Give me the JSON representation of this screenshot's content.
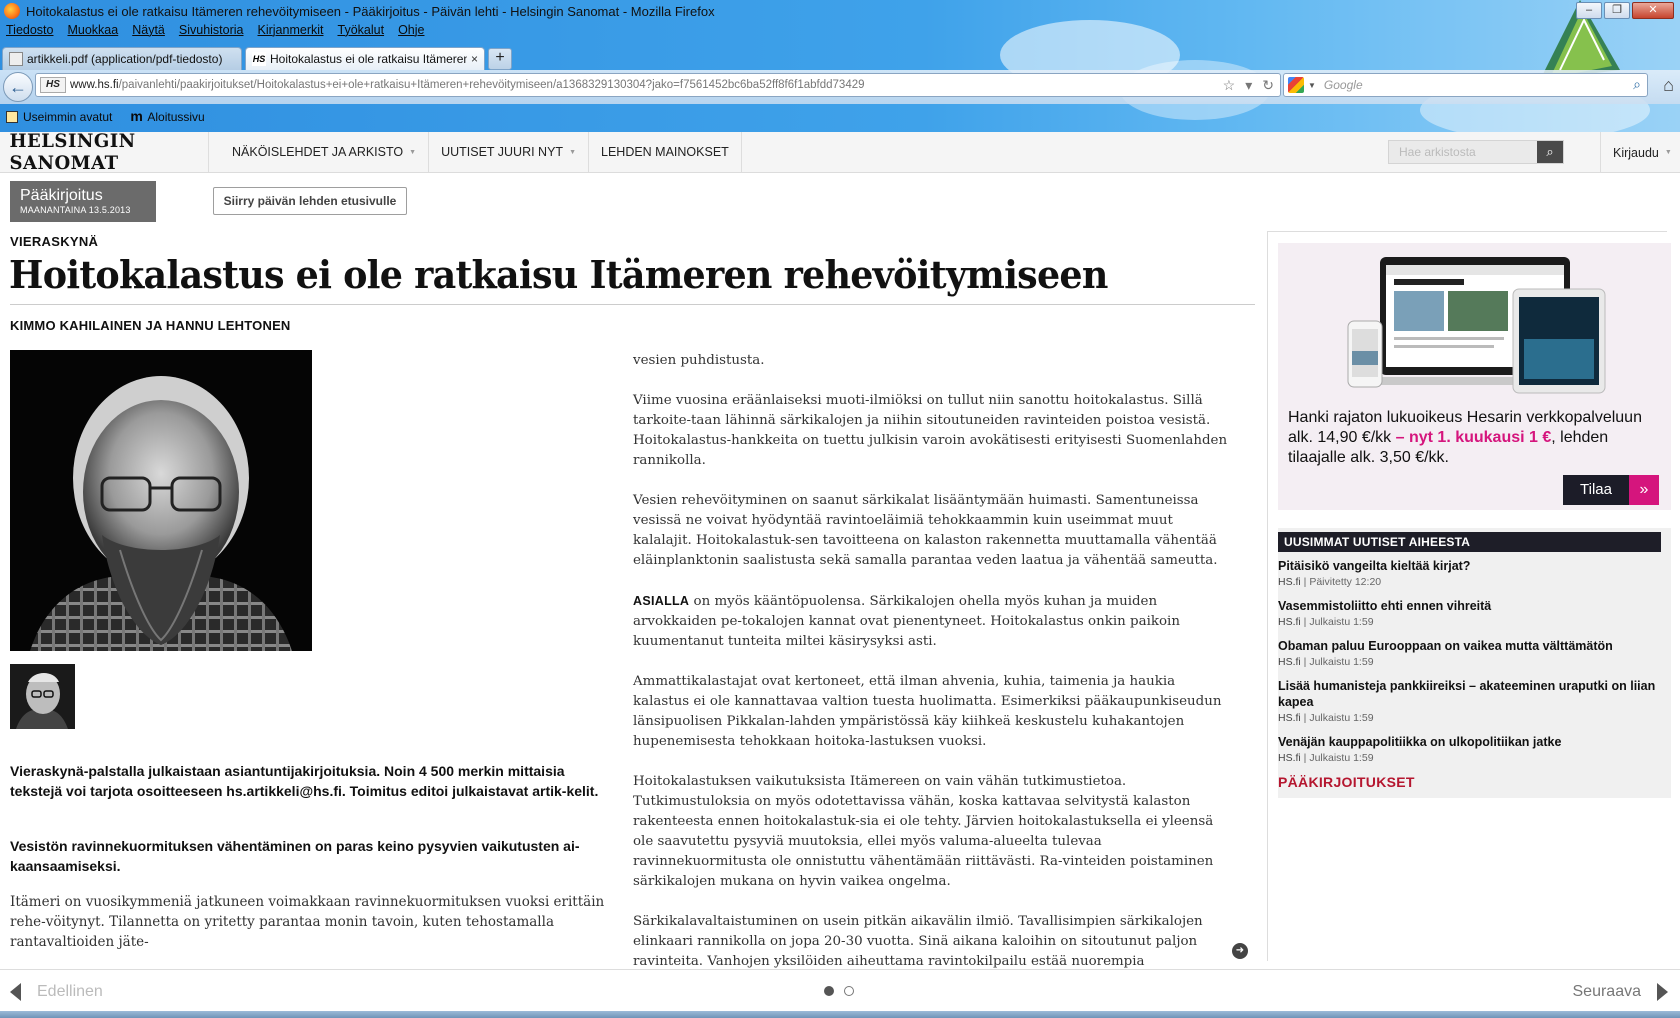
{
  "browser": {
    "window_title": "Hoitokalastus ei ole ratkaisu Itämeren rehevöitymiseen - Pääkirjoitus - Päivän lehti - Helsingin Sanomat - Mozilla Firefox",
    "menu": [
      "Tiedosto",
      "Muokkaa",
      "Näytä",
      "Sivuhistoria",
      "Kirjanmerkit",
      "Työkalut",
      "Ohje"
    ],
    "tabs": [
      {
        "label": "artikkeli.pdf (application/pdf-tiedosto)",
        "favicon": "pdf-icon",
        "active": false
      },
      {
        "label": "Hoitokalastus ei ole ratkaisu Itämeren rehevöitymiseen",
        "favicon": "hs-icon",
        "active": true
      }
    ],
    "newtab_label": "+",
    "tab_close": "×",
    "site_badge": "HS",
    "url_host": "www.hs.fi",
    "url_path": "/paivanlehti/paakirjoitukset/Hoitokalastus+ei+ole+ratkaisu+Itämeren+rehevöitymiseen/a1368329130304?jako=f7561452bc6ba52ff8f6f1abfdd73429",
    "search_placeholder": "Google",
    "bookmarks": [
      "Useimmin avatut",
      "Aloitussivu"
    ]
  },
  "site": {
    "logo": "HELSINGIN SANOMAT",
    "nav": [
      "NÄKÖISLEHDET JA ARKISTO",
      "UUTISET JUURI NYT",
      "LEHDEN MAINOKSET"
    ],
    "search_placeholder": "Hae arkistosta",
    "login": "Kirjaudu"
  },
  "article": {
    "section": "Pääkirjoitus",
    "date": "MAANANTAINA 13.5.2013",
    "frontpage_button": "Siirry päivän lehden etusivulle",
    "kicker": "VIERASKYNÄ",
    "headline": "Hoitokalastus ei ole ratkaisu Itämeren rehevöitymiseen",
    "authors": "KIMMO KAHILAINEN JA HANNU LEHTONEN",
    "left_paragraphs": [
      "Vieraskynä-palstalla julkaistaan asiantuntijakirjoituksia. Noin 4 500 merkin mittaisia tekstejä voi tarjota osoitteeseen hs.artikkeli@hs.fi. Toimitus editoi julkaistavat artik-kelit.",
      "Vesistön ravinnekuormituksen vähentäminen on paras keino pysyvien vaikutusten ai-kaansaamiseksi.",
      "Itämeri on vuosikymmeniä jatkuneen voimakkaan ravinnekuormituksen vuoksi erittäin rehe-vöitynyt. Tilannetta on yritetty parantaa monin tavoin, kuten tehostamalla rantavaltioiden jäte-"
    ],
    "right_paragraphs": [
      "vesien puhdistusta.",
      "Viime vuosina eräänlaiseksi muoti-ilmiöksi on tullut niin sanottu hoitokalastus. Sillä tarkoite-taan lähinnä särkikalojen ja niihin sitoutuneiden ravinteiden poistoa vesistä. Hoitokalastus-hankkeita on tuettu julkisin varoin avokätisesti erityisesti Suomenlahden rannikolla.",
      "Vesien rehevöityminen on saanut särkikalat lisääntymään huimasti. Samentuneissa vesissä ne voivat hyödyntää ravintoeläimiä tehokkaammin kuin useimmat muut kalalajit. Hoitokalastuk-sen tavoitteena on kalaston rakennetta muuttamalla vähentää eläinplanktonin saalistusta sekä samalla parantaa veden laatua ja vähentää sameutta.",
      "on myös kääntöpuolensa. Särkikalojen ohella myös kuhan ja muiden arvokkaiden pe-tokalojen kannat ovat pienentyneet. Hoitokalastus onkin paikoin kuumentanut tunteita miltei käsirysyksi asti.",
      "Ammattikalastajat ovat kertoneet, että ilman ahvenia, kuhia, taimenia ja haukia kalastus ei ole kannattavaa valtion tuesta huolimatta. Esimerkiksi pääkaupunkiseudun länsipuolisen Pikkalan-lahden ympäristössä käy kiihkeä keskustelu kuhakantojen hupenemisesta tehokkaan hoitoka-lastuksen vuoksi.",
      "Hoitokalastuksen vaikutuksista Itämereen on vain vähän tutkimustietoa. Tutkimustuloksia on myös odotettavissa vähän, koska kattavaa selvitystä kalaston rakenteesta ennen hoitokalastuk-sia ei ole tehty. Järvien hoitokalastuksella ei yleensä ole saavutettu pysyviä muutoksia, ellei myös valuma-alueelta tulevaa ravinnekuormitusta ole onnistuttu vähentämään riittävästi. Ra-vinteiden poistaminen särkikalojen mukana on hyvin vaikea ongelma.",
      "Särkikalavaltaistuminen on usein pitkän aikavälin ilmiö. Tavallisimpien särkikalojen elinkaari rannikolla on jopa 20-30 vuotta. Sinä aikana kaloihin on sitoutunut paljon ravinteita. Vanhojen yksilöiden aiheuttama ravintokilpailu estää nuorempia vuosiluokkia yleistymästä."
    ],
    "lead_word": "ASIALLA"
  },
  "sidebar": {
    "promo_text": "Hanki rajaton lukuoikeus Hesarin verkkopalveluun alk. 14,90 €/kk",
    "promo_highlight": "– nyt 1. kuukausi 1 €",
    "promo_tail": ", lehden tilaajalle alk. 3,50 €/kk.",
    "promo_button": "Tilaa",
    "promo_button_arrow": "»",
    "news_header": "UUSIMMAT UUTISET AIHEESTA",
    "news": [
      {
        "title": "Pitäisikö vangeilta kieltää kirjat?",
        "source": "HS.fi",
        "time": "Päivitetty 12:20"
      },
      {
        "title": "Vasemmistoliitto ehti ennen vihreitä",
        "source": "HS.fi",
        "time": "Julkaistu 1:59"
      },
      {
        "title": "Obaman paluu Eurooppaan on vaikea mutta välttämätön",
        "source": "HS.fi",
        "time": "Julkaistu 1:59"
      },
      {
        "title": "Lisää humanisteja pankkiireiksi – akateeminen uraputki on liian kapea",
        "source": "HS.fi",
        "time": "Julkaistu 1:59"
      },
      {
        "title": "Venäjän kauppapolitiikka on ulkopolitiikan jatke",
        "source": "HS.fi",
        "time": "Julkaistu 1:59"
      }
    ],
    "more_link": "PÄÄKIRJOITUKSET"
  },
  "pager": {
    "prev": "Edellinen",
    "next": "Seuraava",
    "pages": 2,
    "current_page": 1
  },
  "colors": {
    "accent_pink": "#d5157d",
    "editorial_red": "#b5162f",
    "dark_navy": "#1e1e28"
  }
}
